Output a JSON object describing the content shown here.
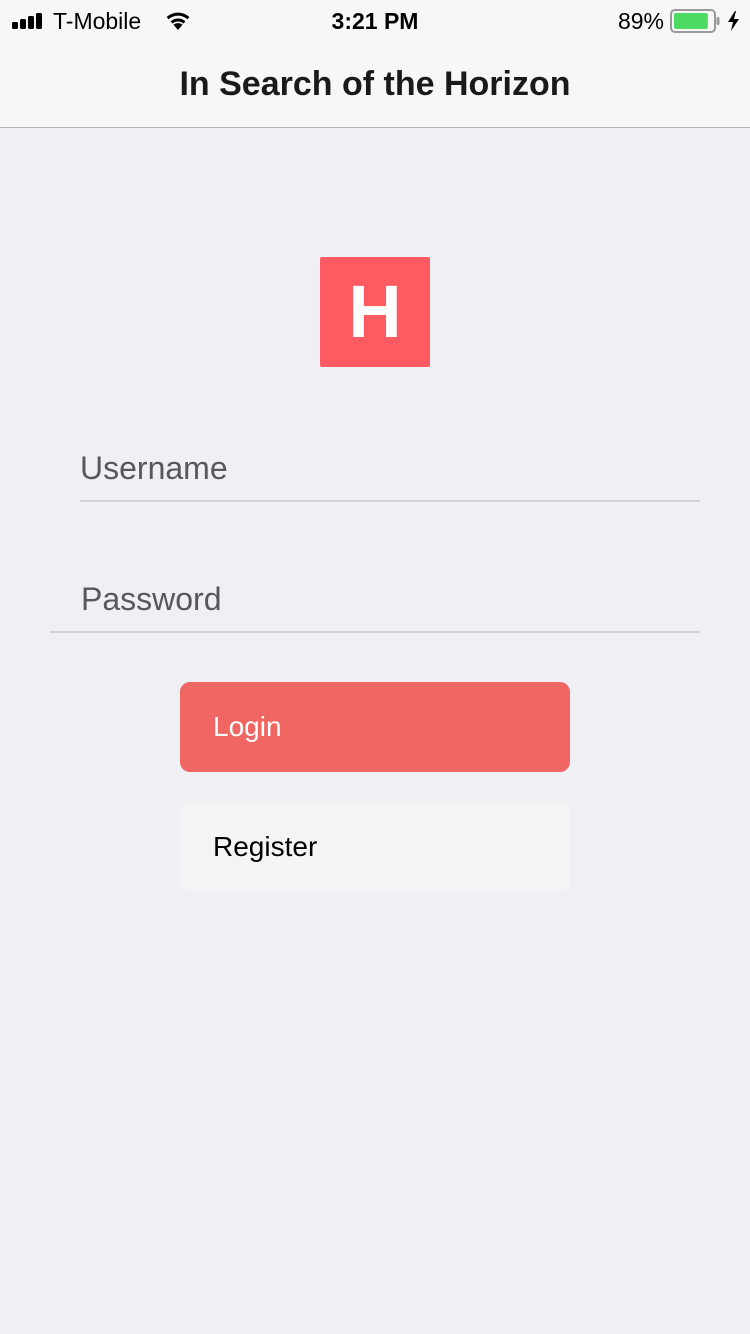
{
  "status_bar": {
    "carrier": "T-Mobile",
    "time": "3:21 PM",
    "battery_percent": "89%",
    "battery_level": 0.89,
    "battery_color": "#4cd964",
    "signal_icon": "signal-bars-icon",
    "wifi_icon": "wifi-icon",
    "charging_icon": "charging-bolt-icon"
  },
  "nav": {
    "title": "In Search of the Horizon"
  },
  "logo": {
    "letter": "H",
    "color": "#fe5a61"
  },
  "form": {
    "username": {
      "placeholder": "Username",
      "value": ""
    },
    "password": {
      "placeholder": "Password",
      "value": ""
    },
    "login_label": "Login",
    "register_label": "Register"
  },
  "colors": {
    "login_button": "#ef6663",
    "register_button": "#f4f4f4",
    "background": "#efeff4"
  }
}
